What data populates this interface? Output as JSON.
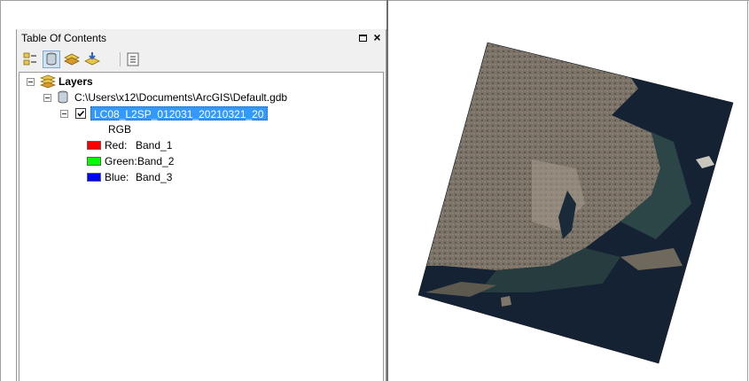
{
  "toc": {
    "title": "Table Of Contents",
    "toolbar": [
      {
        "icon": "list-by-drawing-order-icon"
      },
      {
        "icon": "list-by-source-icon"
      },
      {
        "icon": "list-by-visibility-icon"
      },
      {
        "icon": "list-by-selection-icon"
      },
      {
        "icon": "options-icon"
      }
    ],
    "tree": {
      "root_label": "Layers",
      "source_path": "C:\\Users\\x12\\Documents\\ArcGIS\\Default.gdb",
      "layer_name": "LC08_L2SP_012031_20210321_20",
      "layer_checked": true,
      "render_type": "RGB",
      "bands": [
        {
          "channel": "Red:",
          "band": "Band_1",
          "color": "#ff0000"
        },
        {
          "channel": "Green:",
          "band": "Band_2",
          "color": "#00ff00"
        },
        {
          "channel": "Blue:",
          "band": "Band_3",
          "color": "#0000ff"
        }
      ]
    }
  },
  "map": {
    "content": "satellite-raster-image",
    "colors": {
      "land": "#7a7266",
      "water": "#142234",
      "shallow": "#2f4a4a"
    }
  }
}
